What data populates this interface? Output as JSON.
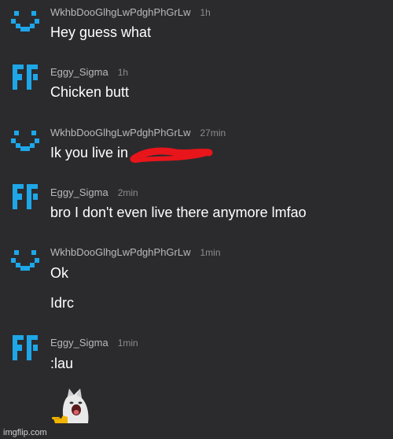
{
  "messages": [
    {
      "author": "WkhbDooGlhgLwPdghPhGrLw",
      "time": "1h",
      "avatar_icon": "pixel-face-icon",
      "lines": [
        "Hey guess what"
      ]
    },
    {
      "author": "Eggy_Sigma",
      "time": "1h",
      "avatar_icon": "pixel-block-icon",
      "lines": [
        "Chicken butt"
      ]
    },
    {
      "author": "WkhbDooGlhgLwPdghPhGrLw",
      "time": "27min",
      "avatar_icon": "pixel-face-icon",
      "lines": [
        "Ik you live in "
      ],
      "redacted": true
    },
    {
      "author": "Eggy_Sigma",
      "time": "2min",
      "avatar_icon": "pixel-block-icon",
      "lines": [
        "bro I don't even live there anymore lmfao"
      ]
    },
    {
      "author": "WkhbDooGlhgLwPdghPhGrLw",
      "time": "1min",
      "avatar_icon": "pixel-face-icon",
      "lines": [
        "Ok",
        "Idrc"
      ]
    },
    {
      "author": "Eggy_Sigma",
      "time": "1min",
      "avatar_icon": "pixel-block-icon",
      "lines": [
        ":lau"
      ],
      "image_icon": "laughing-cat-pointing-icon"
    }
  ],
  "watermark": "imgflip.com",
  "colors": {
    "background": "#2b2b2e",
    "avatar": "#1ea7e8",
    "redaction": "#e8151b"
  }
}
